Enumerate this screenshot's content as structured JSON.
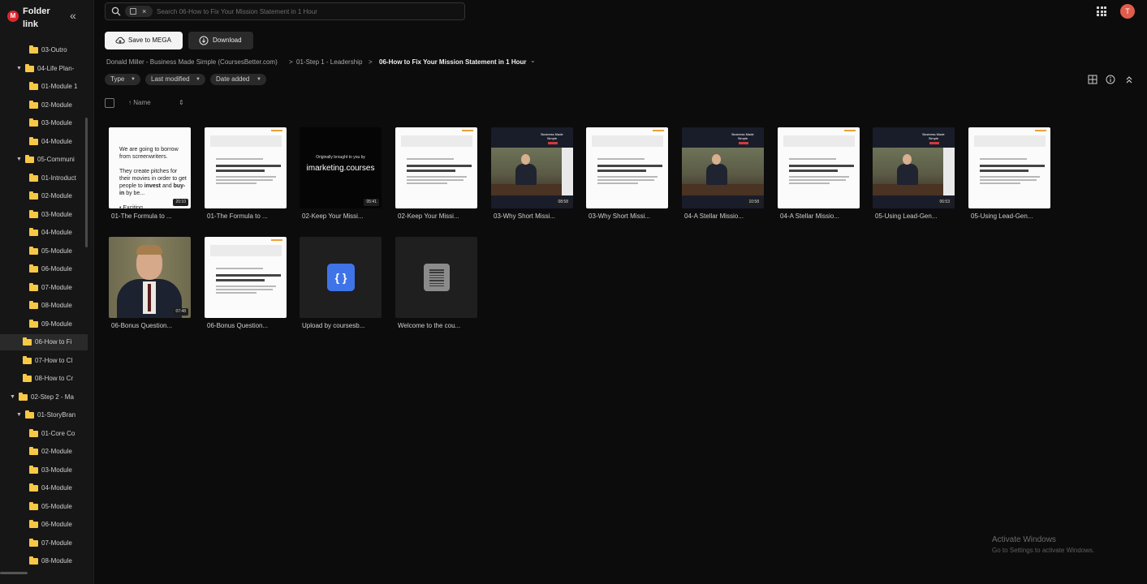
{
  "sidebar": {
    "logo": "M",
    "title": "Folder link",
    "collapse_glyph": "«",
    "items": [
      {
        "label": "03-Outro",
        "level": 2
      },
      {
        "label": "04-Life Plan-",
        "level": 1,
        "expanded": true
      },
      {
        "label": "01-Module 1",
        "level": 2
      },
      {
        "label": "02-Module",
        "level": 2
      },
      {
        "label": "03-Module",
        "level": 2
      },
      {
        "label": "04-Module",
        "level": 2
      },
      {
        "label": "05-Communi",
        "level": 1,
        "expanded": true
      },
      {
        "label": "01-Introduct",
        "level": 2
      },
      {
        "label": "02-Module",
        "level": 2
      },
      {
        "label": "03-Module",
        "level": 2
      },
      {
        "label": "04-Module",
        "level": 2
      },
      {
        "label": "05-Module",
        "level": 2
      },
      {
        "label": "06-Module",
        "level": 2
      },
      {
        "label": "07-Module",
        "level": 2
      },
      {
        "label": "08-Module",
        "level": 2
      },
      {
        "label": "09-Module",
        "level": 2
      },
      {
        "label": "06-How to Fi",
        "level": 1,
        "selected": true
      },
      {
        "label": "07-How to Cl",
        "level": 1
      },
      {
        "label": "08-How to Cr",
        "level": 1
      },
      {
        "label": "02-Step 2 - Ma",
        "level": 0,
        "expanded": true
      },
      {
        "label": "01-StoryBran",
        "level": 1,
        "expanded": true
      },
      {
        "label": "01-Core Co",
        "level": 2
      },
      {
        "label": "02-Module",
        "level": 2
      },
      {
        "label": "03-Module",
        "level": 2
      },
      {
        "label": "04-Module",
        "level": 2
      },
      {
        "label": "05-Module",
        "level": 2
      },
      {
        "label": "06-Module",
        "level": 2
      },
      {
        "label": "07-Module",
        "level": 2
      },
      {
        "label": "08-Module",
        "level": 2
      }
    ]
  },
  "search": {
    "placeholder": "Search 06-How to Fix Your Mission Statement in 1 Hour",
    "chip_close": "×"
  },
  "header": {
    "avatar_initial": "T"
  },
  "actions": {
    "save_label": "Save to MEGA",
    "download_label": "Download"
  },
  "breadcrumb": {
    "root": "Donald Miller - Business Made Simple (CoursesBetter.com)",
    "sep": ">",
    "parent": "01-Step 1 - Leadership",
    "current": "06-How to Fix Your Mission Statement in 1 Hour",
    "caret": "⌄"
  },
  "filters": {
    "type": "Type",
    "last_modified": "Last modified",
    "date_added": "Date added",
    "caret": "▼"
  },
  "columns": {
    "name_label": "↑ Name",
    "sort_glyph": "⇕"
  },
  "files": [
    {
      "name": "01-The Formula to ...",
      "kind": "slide",
      "duration": "20:10",
      "slide_line1": "We are going to borrow from screenwriters.",
      "slide_line2": "They create pitches for their movies in order to get people to",
      "slide_bold1": "invest",
      "slide_mid": "and",
      "slide_bold2": "buy-in",
      "slide_end": "by be...",
      "slide_bullet": "• Exciting"
    },
    {
      "name": "01-The Formula to ...",
      "kind": "doc"
    },
    {
      "name": "02-Keep Your Missi...",
      "kind": "black",
      "duration": "05:41",
      "line1": "Originally brought to you by",
      "line2": "imarketing.courses"
    },
    {
      "name": "02-Keep Your Missi...",
      "kind": "doc"
    },
    {
      "name": "03-Why Short Missi...",
      "kind": "video",
      "duration": "08:58",
      "video_title": "Business Made Simple"
    },
    {
      "name": "03-Why Short Missi...",
      "kind": "doc"
    },
    {
      "name": "04-A Stellar Missio...",
      "kind": "video",
      "duration": "10:58",
      "video_title": "Business Made Simple"
    },
    {
      "name": "04-A Stellar Missio...",
      "kind": "doc"
    },
    {
      "name": "05-Using Lead-Gen...",
      "kind": "video",
      "duration": "06:53",
      "video_title": "Business Made Simple"
    },
    {
      "name": "05-Using Lead-Gen...",
      "kind": "doc"
    },
    {
      "name": "06-Bonus Question...",
      "kind": "portrait",
      "duration": "07:48"
    },
    {
      "name": "06-Bonus Question...",
      "kind": "doc"
    },
    {
      "name": "Upload by coursesb...",
      "kind": "code",
      "icon_glyph": "{ }"
    },
    {
      "name": "Welcome to the cou...",
      "kind": "text"
    }
  ],
  "watermark": {
    "line1": "Activate Windows",
    "line2": "Go to Settings to activate Windows."
  },
  "icons": [
    "search-icon",
    "cloud-upload-icon",
    "download-icon",
    "apps-grid-icon",
    "grid-view-icon",
    "info-icon",
    "chevrons-up-icon",
    "folder-icon",
    "chevron-down-icon"
  ]
}
